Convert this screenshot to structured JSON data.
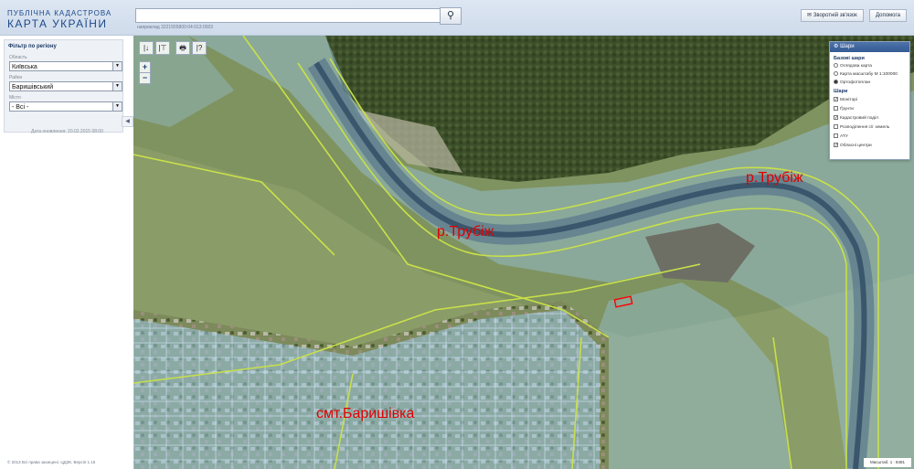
{
  "header": {
    "logo_line1": "ПУБЛІЧНА КАДАСТРОВА",
    "logo_line2": "КАРТА УКРАЇНИ",
    "search_placeholder": "",
    "search_example": "наприклад 3221555800:04:013:0003",
    "feedback_label": "Зворотній зв'язок",
    "help_label": "Допомога"
  },
  "sidebar": {
    "filter_title": "Фільтр по регіону",
    "oblast_label": "Область",
    "oblast_value": "Київська",
    "rayon_label": "Район",
    "rayon_value": "Баришівський",
    "misto_label": "Місто",
    "misto_value": "- Всі -",
    "updated_text": "Дата оновлення: 20.02.2015 08:00",
    "copyright": "© 2013 Всі права захищені. ЦДЗК. Версія 1.15"
  },
  "map": {
    "labels": {
      "river1": "р.Трубіж",
      "river2": "р.Трубіж",
      "town": "смт.Баришівка"
    },
    "tools": [
      "|↓",
      "|⊤",
      "🖶",
      "|?"
    ],
    "zoom_in": "+",
    "zoom_out": "−",
    "scale_text": "Масштаб: 1 : 8481",
    "highlight_color": "#ff0000",
    "parcel_color": "#9cc9ec",
    "boundary_color": "#c8e04a"
  },
  "layers": {
    "title": "Шари",
    "base_title": "Базові шари",
    "base": [
      {
        "label": "Оглядова карта",
        "selected": false
      },
      {
        "label": "Карта масштабу М 1:100000",
        "selected": false
      },
      {
        "label": "Ортофотоплан",
        "selected": true
      }
    ],
    "layers_title": "Шари",
    "items": [
      {
        "label": "Моніторі",
        "checked": true
      },
      {
        "label": "Ґрунти",
        "checked": false
      },
      {
        "label": "Кадастровий поділ",
        "checked": true
      },
      {
        "label": "Розподілення с/г земель",
        "checked": false
      },
      {
        "label": "АТУ",
        "checked": false
      },
      {
        "label": "Обласні центри",
        "checked": true
      }
    ]
  }
}
